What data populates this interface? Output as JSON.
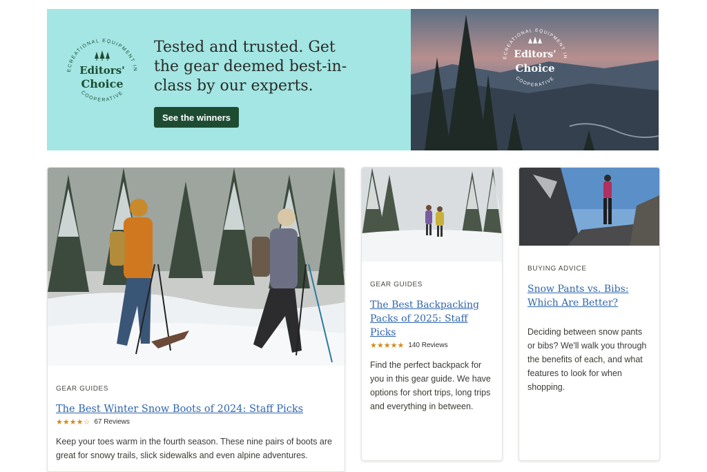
{
  "hero": {
    "badge": {
      "ring_text": "RECREATIONAL EQUIPMENT INC",
      "bottom_text": "COOPERATIVE",
      "line1": "Editors'",
      "line2": "Choice"
    },
    "headline": "Tested and trusted. Get the gear deemed best-in-class by our experts.",
    "cta_label": "See the winners",
    "colors": {
      "background": "#a3e6e3",
      "cta": "#1e4c33"
    }
  },
  "cards": [
    {
      "eyebrow": "GEAR GUIDES",
      "title": "The Best Winter Snow Boots of 2024: Staff Picks",
      "rating": 3.5,
      "stars": "★★★★☆",
      "reviews": "67  Reviews",
      "description": "Keep your toes warm in the fourth season. These nine pairs of boots are great for snowy trails, slick sidewalks and even alpine adventures.",
      "image": "snowshoe-hikers-photo"
    },
    {
      "eyebrow": "GEAR GUIDES",
      "title": "The Best Backpacking Packs of 2025: Staff Picks",
      "rating": 4.5,
      "stars": "★★★★★",
      "reviews": "140  Reviews",
      "description": "Find the perfect backpack for you in this gear guide. We have options for short trips, long trips and everything in between.",
      "image": "backpackers-snowy-trail-photo"
    },
    {
      "eyebrow": "BUYING ADVICE",
      "title": "Snow Pants vs. Bibs: Which Are Better?",
      "description": "Deciding between snow pants or bibs? We'll walk you through the benefits of each, and what features to look for when shopping.",
      "image": "climber-on-rock-photo"
    }
  ]
}
